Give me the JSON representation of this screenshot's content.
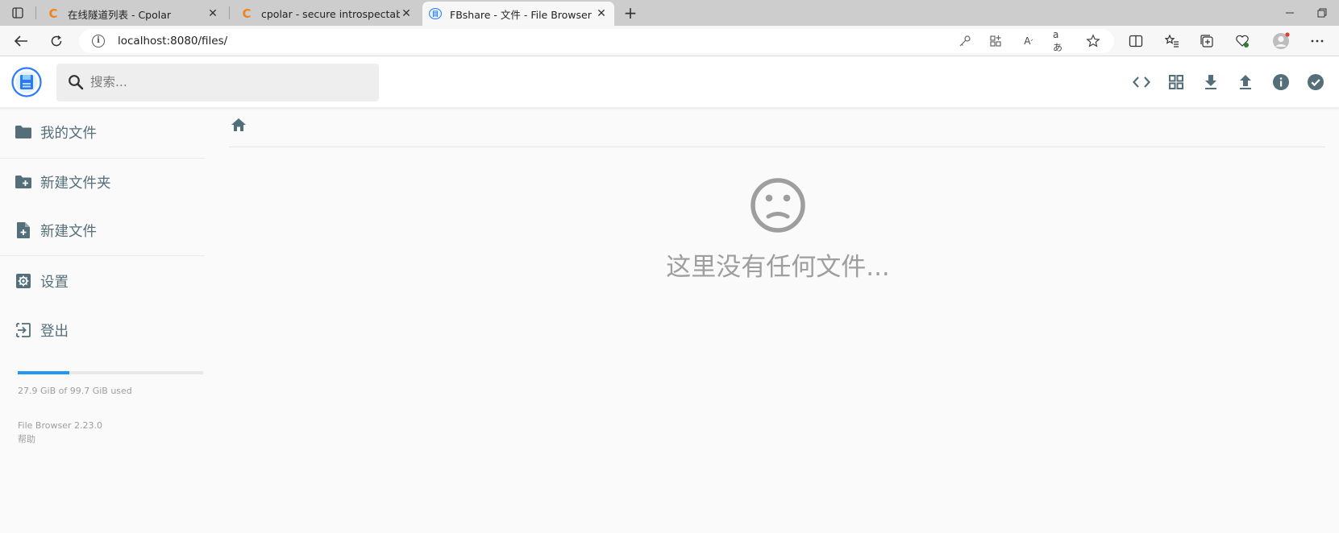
{
  "browser": {
    "tabs": [
      {
        "title": "在线隧道列表 - Cpolar",
        "favicon": "cpolar-icon"
      },
      {
        "title": "cpolar - secure introspectable tunnels",
        "favicon": "cpolar-icon"
      },
      {
        "title": "FBshare - 文件 - File Browser",
        "favicon": "filebrowser-icon",
        "active": true
      }
    ],
    "address": "localhost:8080/files/"
  },
  "header": {
    "search_placeholder": "搜索..."
  },
  "sidebar": {
    "items": [
      {
        "label": "我的文件",
        "icon": "folder-icon"
      },
      {
        "label": "新建文件夹",
        "icon": "create-folder-icon"
      },
      {
        "label": "新建文件",
        "icon": "create-file-icon"
      },
      {
        "label": "设置",
        "icon": "settings-icon"
      },
      {
        "label": "登出",
        "icon": "logout-icon"
      }
    ],
    "usage": {
      "text": "27.9 GiB of 99.7 GiB used",
      "fraction": 0.28
    },
    "version": "File Browser 2.23.0",
    "help": "帮助"
  },
  "main": {
    "empty_text": "这里没有任何文件..."
  },
  "colors": {
    "accent": "#2196f3",
    "sidebar_text": "#546e7a",
    "muted": "#9e9e9e"
  }
}
